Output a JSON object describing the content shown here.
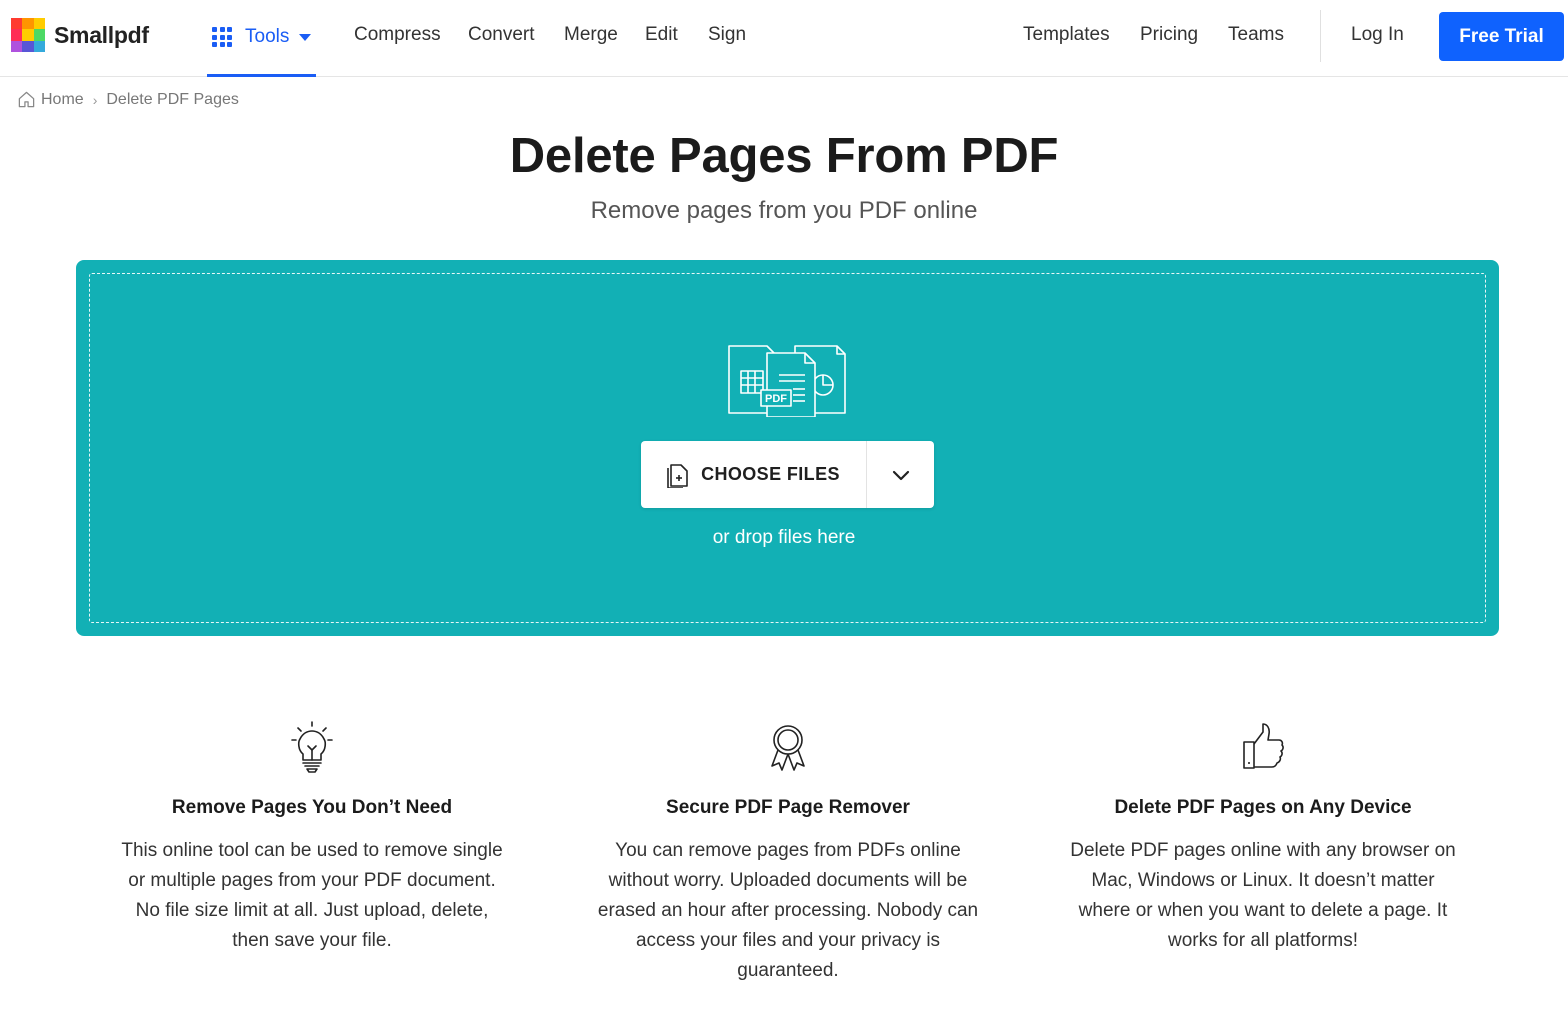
{
  "brand": {
    "name": "Smallpdf",
    "logo_colors": [
      "#ff3b30",
      "#ffcc00",
      "#4cd964",
      "#ff9500",
      "#ffcc00",
      "#34c759",
      "#af52de",
      "#5856d6",
      "#007aff"
    ]
  },
  "nav": {
    "tools_label": "Tools",
    "left_links": [
      "Compress",
      "Convert",
      "Merge",
      "Edit",
      "Sign"
    ],
    "right_links": [
      "Templates",
      "Pricing",
      "Teams"
    ],
    "login": "Log In",
    "free_trial": "Free Trial"
  },
  "breadcrumb": {
    "home": "Home",
    "separator": "›",
    "current": "Delete PDF Pages"
  },
  "hero": {
    "title": "Delete Pages From PDF",
    "subtitle": "Remove pages from you PDF online"
  },
  "dropzone": {
    "graphic_label": "PDF",
    "choose_label": "CHOOSE FILES",
    "drop_hint": "or drop files here",
    "background": "#12b0b5"
  },
  "features": [
    {
      "icon": "lightbulb-icon",
      "title": "Remove Pages You Don’t Need",
      "lines": [
        "This online tool can be used to remove single",
        "or multiple pages from your PDF document.",
        "No file size limit at all. Just upload, delete,",
        "then save your file."
      ]
    },
    {
      "icon": "award-icon",
      "title": "Secure PDF Page Remover",
      "lines": [
        "You can remove pages from PDFs online",
        "without worry. Uploaded documents will be",
        "erased an hour after processing. Nobody can",
        "access your files and your privacy is",
        "guaranteed."
      ]
    },
    {
      "icon": "thumbs-up-icon",
      "title": "Delete PDF Pages on Any Device",
      "lines": [
        "Delete PDF pages online with any browser on",
        "Mac, Windows or Linux. It doesn’t matter",
        "where or when you want to delete a page. It",
        "works for all platforms!"
      ]
    }
  ],
  "colors": {
    "accent": "#1a5df5",
    "cta": "#0f62fe",
    "teal": "#12b0b5"
  }
}
